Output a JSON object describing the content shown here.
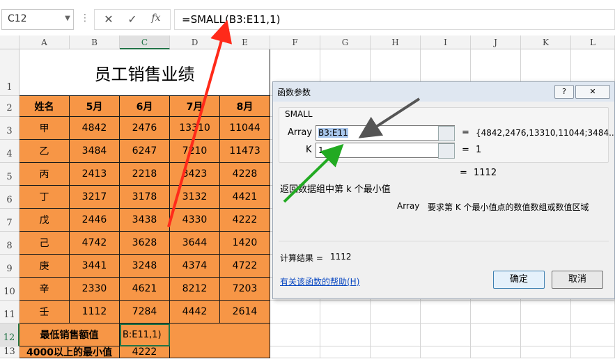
{
  "formula_bar": {
    "name_box": "C12",
    "dots": "⋮",
    "cancel_glyph": "✕",
    "enter_glyph": "✓",
    "fx_glyph": "fx",
    "formula": "=SMALL(B3:E11,1)"
  },
  "columns": [
    "A",
    "B",
    "C",
    "D",
    "E",
    "F",
    "G",
    "H",
    "I",
    "J",
    "K",
    "L"
  ],
  "rows": [
    "1",
    "2",
    "3",
    "4",
    "5",
    "6",
    "7",
    "8",
    "9",
    "10",
    "11",
    "12",
    "13"
  ],
  "sheet": {
    "title": "员工销售业绩",
    "headers": [
      "姓名",
      "5月",
      "6月",
      "7月",
      "8月"
    ],
    "data": [
      [
        "甲",
        "4842",
        "2476",
        "13310",
        "11044"
      ],
      [
        "乙",
        "3484",
        "6247",
        "7210",
        "11473"
      ],
      [
        "丙",
        "2413",
        "2218",
        "3423",
        "4228"
      ],
      [
        "丁",
        "3217",
        "3178",
        "3132",
        "4421"
      ],
      [
        "戊",
        "2446",
        "3438",
        "4330",
        "4222"
      ],
      [
        "己",
        "4742",
        "3628",
        "3644",
        "1420"
      ],
      [
        "庚",
        "3441",
        "3248",
        "4374",
        "4722"
      ],
      [
        "辛",
        "2330",
        "4621",
        "8212",
        "7203"
      ],
      [
        "壬",
        "1112",
        "7284",
        "4442",
        "2614"
      ]
    ],
    "row12_label": "最低销售额值",
    "row12_edit": "B:E11,1)",
    "row13_label": "4000以上的最小值",
    "row13_value": "4222"
  },
  "dialog": {
    "title": "函数参数",
    "help_btn": "?",
    "close_btn": "✕",
    "function_name": "SMALL",
    "array_label": "Array",
    "array_value": "B3:E11",
    "array_eq": "=",
    "array_result": "{4842,2476,13310,11044;3484...",
    "k_label": "K",
    "k_value": "1",
    "k_eq": "=",
    "k_result": "1",
    "total_eq": "=",
    "total_result": "1112",
    "description": "返回数据组中第 k 个最小值",
    "arg_desc_name": "Array",
    "arg_desc": "要求第 K 个最小值点的数值数组或数值区域",
    "calc_label": "计算结果 =",
    "calc_value": "1112",
    "help_link": "有关该函数的帮助(H)",
    "ok": "确定",
    "cancel": "取消"
  },
  "colors": {
    "orange": "#f79646",
    "red_arrow": "#ff2a1a",
    "gray_arrow": "#555555",
    "green_arrow": "#22aa22",
    "selection": "#217346",
    "link": "#0b49c2"
  }
}
